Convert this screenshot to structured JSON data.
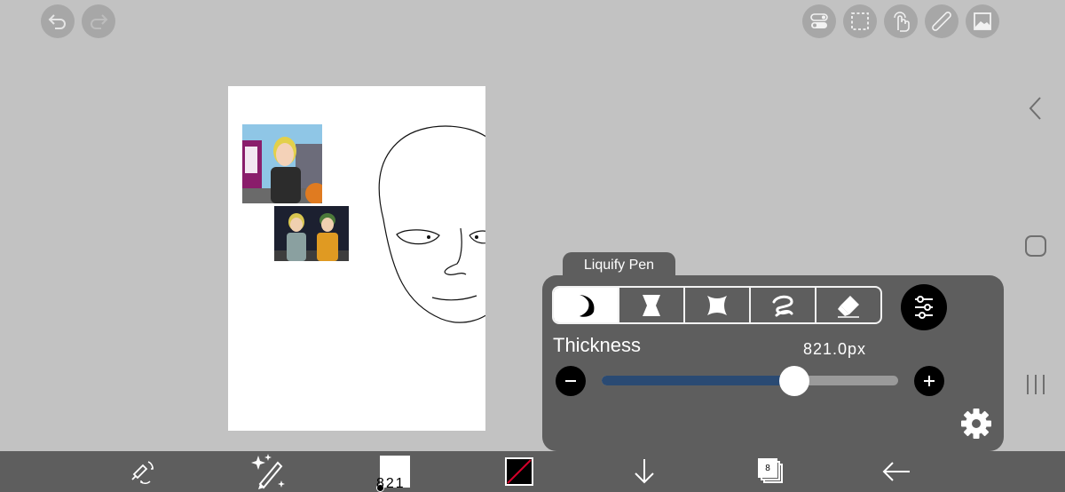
{
  "top_left": {
    "undo_icon": "undo-icon",
    "redo_icon": "redo-icon"
  },
  "top_right": [
    "layers-toggle-icon",
    "selection-icon",
    "touch-icon",
    "ruler-icon",
    "image-icon"
  ],
  "system_nav": [
    "back-chevron-icon",
    "home-square-icon",
    "recents-icon"
  ],
  "panel": {
    "title": "Liquify Pen",
    "modes": [
      "push-mode-icon",
      "pinch-mode-icon",
      "expand-mode-icon",
      "twirl-mode-icon",
      "restore-mode-icon"
    ],
    "active_mode_index": 0,
    "thickness_label": "Thickness",
    "thickness_value": "821.0px",
    "thickness_fraction": 0.65
  },
  "toolbar": {
    "brush_size": "821",
    "layer_count": "8",
    "items": [
      "transform-icon",
      "magic-brush-icon",
      "brush-size",
      "color-swatch",
      "download-icon",
      "layers-icon",
      "back-arrow-icon"
    ]
  },
  "colors": {
    "background": "#c2c2c2",
    "panel": "#5e5e5e",
    "toolbar": "#5e5e5e",
    "slider_fill": "#2a4a73",
    "accent_red": "#d4002a"
  }
}
